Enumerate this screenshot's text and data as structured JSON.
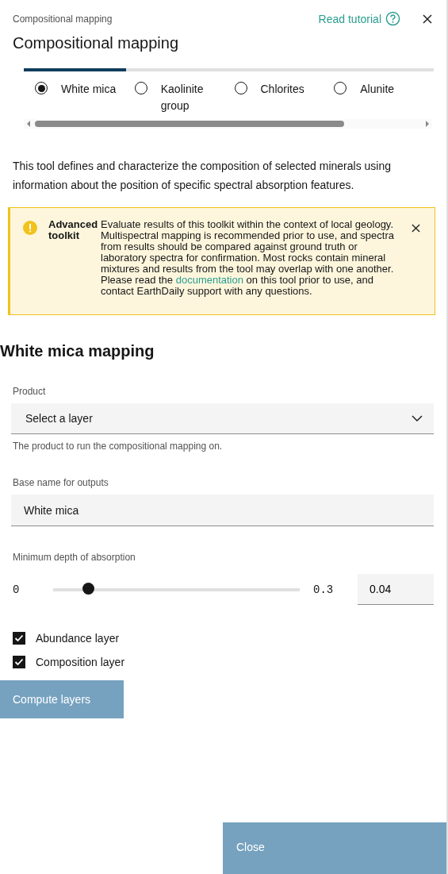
{
  "header": {
    "breadcrumb": "Compositional mapping",
    "title": "Compositional mapping",
    "tutorial_link": "Read tutorial"
  },
  "progress": {
    "level": 0.25
  },
  "minerals": [
    {
      "label": "White mica",
      "selected": true
    },
    {
      "label": "Kaolinite group",
      "selected": false
    },
    {
      "label": "Chlorites",
      "selected": false
    },
    {
      "label": "Alunite",
      "selected": false
    }
  ],
  "description": "This tool defines and characterize the composition of selected minerals using information about the position of specific spectral absorption features.",
  "notice": {
    "title": "Advanced toolkit",
    "text_before": "Evaluate results of this toolkit within the context of local geology. Multispectral mapping is recommended prior to use, and spectra from results should be compared against ground truth or laboratory spectra for confirmation. Most rocks contain mineral mixtures and results from the tool may overlap with one another. Please read the",
    "link": "documentation",
    "text_after": "on this tool prior to use, and contact EarthDaily support with any questions."
  },
  "section_title": "White mica mapping",
  "product": {
    "label": "Product",
    "value": "Select a layer",
    "helper": "The product to run the compositional mapping on."
  },
  "base_name": {
    "label": "Base name for outputs",
    "value": "White mica"
  },
  "depth": {
    "label": "Minimum depth of absorption",
    "min": "0",
    "max": "0.3",
    "level": 0.14,
    "value": "0.04"
  },
  "options": [
    {
      "label": "Abundance layer",
      "checked": true
    },
    {
      "label": "Composition layer",
      "checked": true
    }
  ],
  "compute_button": "Compute layers",
  "close_button": "Close"
}
